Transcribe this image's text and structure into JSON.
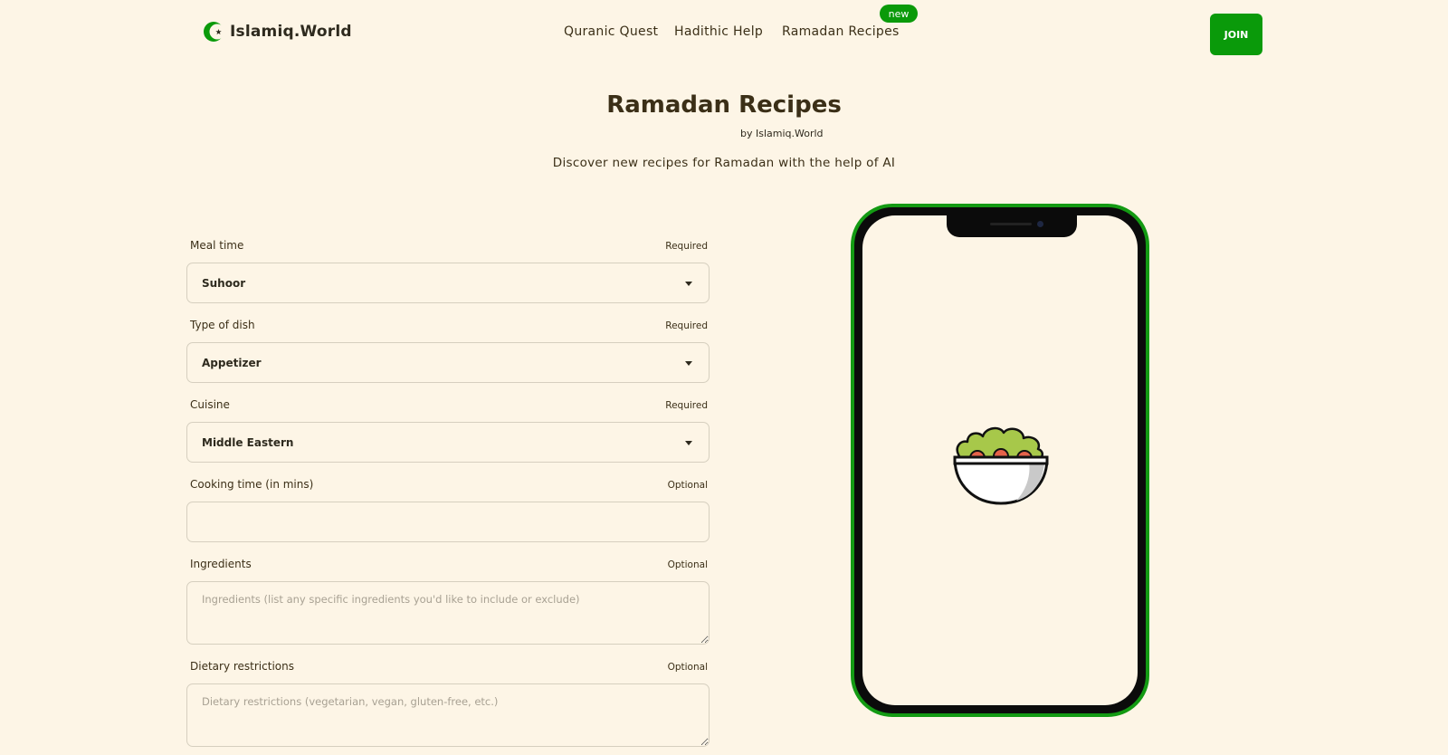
{
  "header": {
    "logo_text": "Islamiq.World",
    "logo_icon": "crescent-star-icon",
    "nav": [
      {
        "label": "Quranic Quest"
      },
      {
        "label": "Hadithic Help"
      },
      {
        "label": "Ramadan Recipes",
        "badge": "new"
      }
    ],
    "join_label": "JOIN"
  },
  "hero": {
    "title": "Ramadan Recipes",
    "byline": "by Islamiq.World",
    "subtitle": "Discover new recipes for Ramadan with the help of AI"
  },
  "form": {
    "meal_time": {
      "label": "Meal time",
      "requirement": "Required",
      "value": "Suhoor"
    },
    "dish_type": {
      "label": "Type of dish",
      "requirement": "Required",
      "value": "Appetizer"
    },
    "cuisine": {
      "label": "Cuisine",
      "requirement": "Required",
      "value": "Middle Eastern"
    },
    "cooking_time": {
      "label": "Cooking time (in mins)",
      "requirement": "Optional",
      "value": ""
    },
    "ingredients": {
      "label": "Ingredients",
      "requirement": "Optional",
      "placeholder": "Ingredients (list any specific ingredients you'd like to include or exclude)"
    },
    "dietary": {
      "label": "Dietary restrictions",
      "requirement": "Optional",
      "placeholder": "Dietary restrictions (vegetarian, vegan, gluten-free, etc.)"
    }
  },
  "preview": {
    "illustration": "salad-bowl-icon"
  },
  "colors": {
    "background": "#fdf5e6",
    "accent": "#0a9a0a",
    "text": "#3b2f17"
  }
}
